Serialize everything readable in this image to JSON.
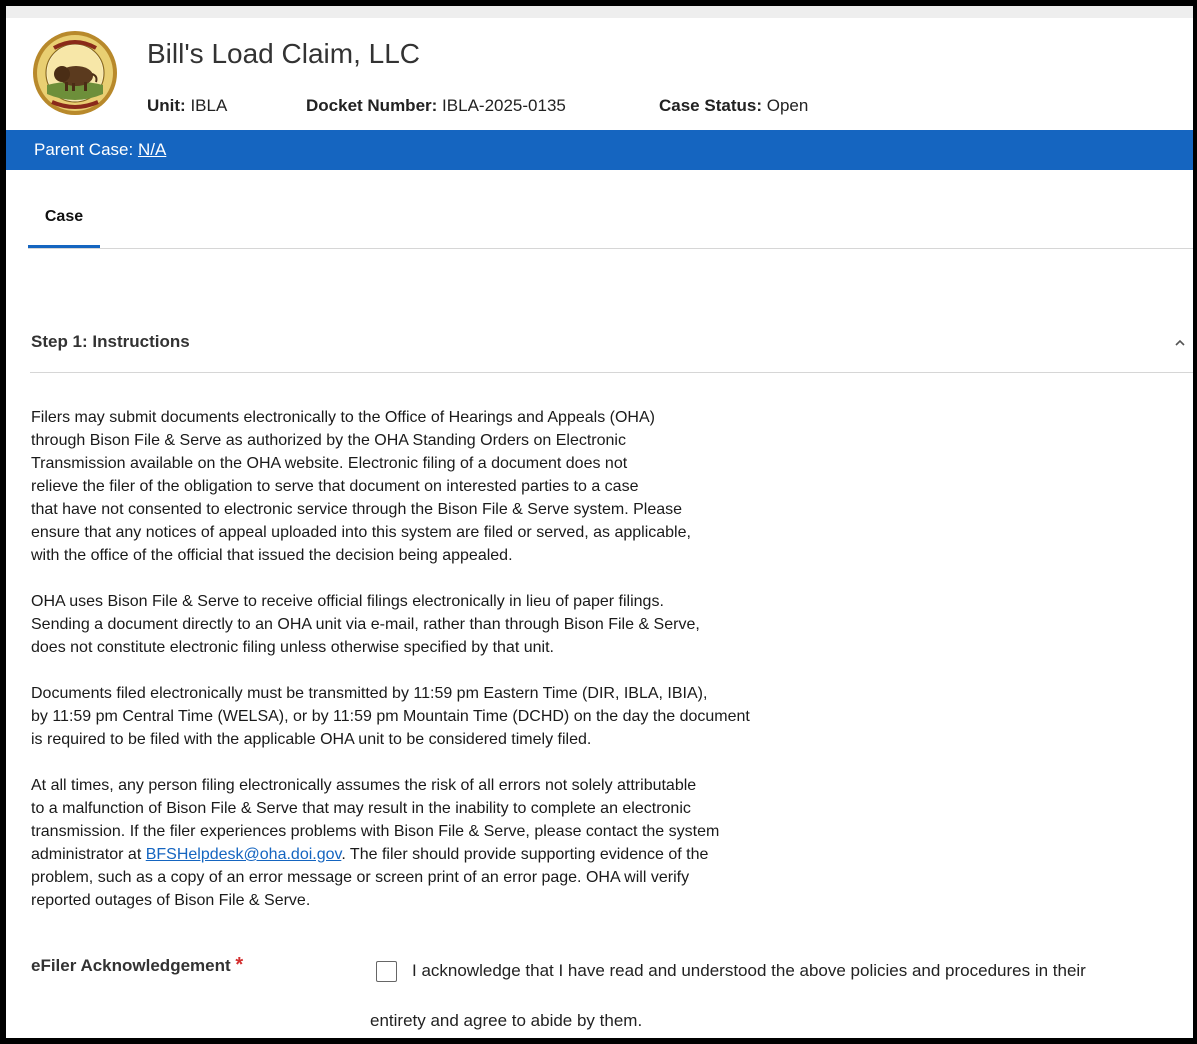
{
  "header": {
    "case_title": "Bill's Load Claim, LLC",
    "unit_label": "Unit:",
    "unit_value": "IBLA",
    "docket_label": "Docket Number:",
    "docket_value": "IBLA-2025-0135",
    "status_label": "Case Status:",
    "status_value": "Open",
    "seal_icon": "doi-seal-icon"
  },
  "parent_case": {
    "label": "Parent Case:",
    "link": "N/A"
  },
  "tabs": [
    {
      "label": "Case",
      "active": true
    }
  ],
  "section": {
    "title": "Step 1: Instructions",
    "chevron_icon": "chevron-up-icon",
    "expanded": true
  },
  "instructions": {
    "para1": "Filers may submit documents electronically to the Office of Hearings and Appeals (OHA)\nthrough Bison File & Serve as authorized by the OHA Standing Orders on Electronic\nTransmission available on the OHA website. Electronic filing of a document does not\nrelieve the filer of the obligation to serve that document on interested parties to a case\nthat have not consented to electronic service through the Bison File & Serve system. Please\nensure that any notices of appeal uploaded into this system are filed or served, as applicable,\nwith the office of the official that issued the decision being appealed.",
    "para2": "OHA uses Bison File & Serve to receive official filings electronically in lieu of paper filings.\nSending a document directly to an OHA unit via e-mail, rather than through Bison File & Serve,\ndoes not constitute electronic filing unless otherwise specified by that unit.",
    "para3": "Documents filed electronically must be transmitted by 11:59 pm Eastern Time (DIR, IBLA, IBIA),\nby 11:59 pm Central Time (WELSA), or by 11:59 pm Mountain Time (DCHD) on the day the document\nis required to be filed with the applicable OHA unit to be considered timely filed.",
    "para4_part1": "At all times, any person filing electronically assumes the risk of all errors not solely attributable\nto a malfunction of Bison File & Serve that may result in the inability to complete an electronic\ntransmission. If the filer experiences problems with Bison File & Serve, please contact the system\nadministrator at ",
    "para4_link": "BFSHelpdesk@oha.doi.gov",
    "para4_part2": ". The filer should provide supporting evidence of the\nproblem, such as a copy of an error message or screen print of an error page. OHA will verify\nreported outages of Bison File & Serve."
  },
  "acknowledgement": {
    "label": "eFiler Acknowledgement",
    "required_marker": "*",
    "checked": false,
    "text_line1": "I acknowledge that I have read and understood the above policies and procedures in their",
    "text_line2": "entirety and agree to abide by them."
  },
  "colors": {
    "accent": "#1565c0",
    "required": "#d32f2f"
  }
}
